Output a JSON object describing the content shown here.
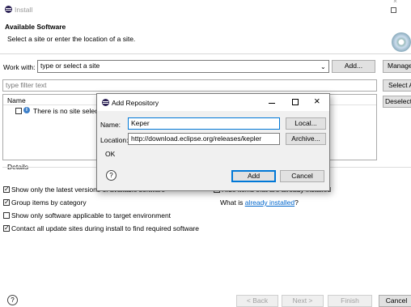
{
  "window": {
    "title": "Install",
    "icon": "eclipse-icon"
  },
  "header": {
    "title": "Available Software",
    "subtitle": "Select a site or enter the location of a site."
  },
  "work_with": {
    "label": "Work with:",
    "placeholder": "type or select a site",
    "add_button": "Add...",
    "manage_button": "Manage"
  },
  "filter": {
    "placeholder": "type filter text",
    "select_all_button": "Select A",
    "deselect_all_button": "Deselect"
  },
  "tree": {
    "column_name": "Name",
    "info_row": "There is no site selecte"
  },
  "details": {
    "label": "Details"
  },
  "options": [
    {
      "label": "Show only the latest versions of available software",
      "checked": true
    },
    {
      "label": "Group items by category",
      "checked": true
    },
    {
      "label": "Show only software applicable to target environment",
      "checked": false
    },
    {
      "label": "Contact all update sites during install to find required software",
      "checked": true
    }
  ],
  "options_right": {
    "hide_installed": "Hide items that are already installed",
    "what_is_prefix": "What is ",
    "already_installed_link": "already installed",
    "what_is_suffix": "?"
  },
  "footer": {
    "back": "< Back",
    "next": "Next >",
    "finish": "Finish",
    "cancel": "Cancel"
  },
  "dialog": {
    "title": "Add Repository",
    "name_label": "Name:",
    "name_value": "Keper",
    "local_button": "Local...",
    "location_label": "Location:",
    "location_value": "http://download.eclipse.org/releases/kepler",
    "archive_button": "Archive...",
    "status": "OK",
    "add_button": "Add",
    "cancel_button": "Cancel"
  },
  "colors": {
    "link": "#0066cc",
    "focus": "#0078d7",
    "button_bg": "#e1e1e1"
  }
}
